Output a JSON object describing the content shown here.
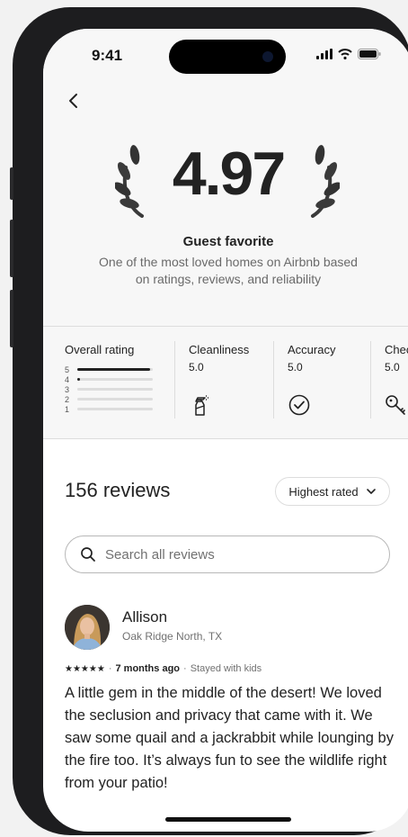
{
  "status_bar": {
    "time": "9:41"
  },
  "header": {
    "score": "4.97",
    "badge_title": "Guest favorite",
    "badge_subtitle": "One of the most loved homes on Airbnb based on ratings, reviews, and reliability"
  },
  "ratings": {
    "overall_title": "Overall rating",
    "distribution": [
      {
        "label": "5",
        "fraction": 0.97
      },
      {
        "label": "4",
        "fraction": 0.03
      },
      {
        "label": "3",
        "fraction": 0.0
      },
      {
        "label": "2",
        "fraction": 0.0
      },
      {
        "label": "1",
        "fraction": 0.0
      }
    ],
    "categories": [
      {
        "title": "Cleanliness",
        "value": "5.0",
        "icon": "spray-bottle-icon"
      },
      {
        "title": "Accuracy",
        "value": "5.0",
        "icon": "check-circle-icon"
      },
      {
        "title": "Check-in",
        "value": "5.0",
        "icon": "key-icon"
      }
    ]
  },
  "reviews": {
    "heading": "156 reviews",
    "sort_label": "Highest rated",
    "search_placeholder": "Search all reviews",
    "items": [
      {
        "name": "Allison",
        "location": "Oak Ridge North, TX",
        "stars": "★★★★★",
        "rating": 5,
        "time_ago": "7 months ago",
        "stay": "Stayed with kids",
        "text": "A little gem in the middle of the desert! We loved the seclusion and privacy that came with it. We saw some quail and a jackrabbit while lounging by the fire too. It’s always fun to see the wildlife right from your patio!"
      }
    ]
  }
}
